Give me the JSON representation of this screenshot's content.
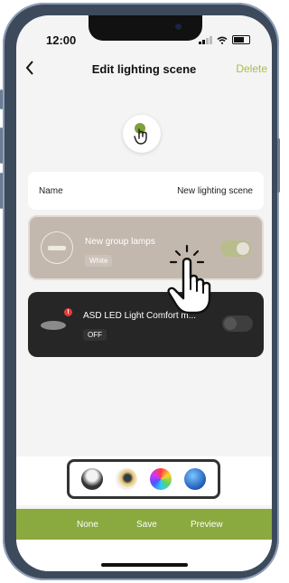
{
  "status_bar": {
    "time": "12:00"
  },
  "header": {
    "back_icon": "chevron-left-icon",
    "title": "Edit lighting scene",
    "delete_label": "Delete"
  },
  "scene_icon": {
    "icon": "tap-hand-icon",
    "accent_color": "#7fa13a"
  },
  "name_row": {
    "label": "Name",
    "value": "New lighting scene"
  },
  "devices": [
    {
      "name": "New group lamps",
      "tag": "White",
      "toggle_on": true,
      "selected": true
    },
    {
      "name": "ASD LED Light Comfort m...",
      "tag": "OFF",
      "toggle_on": false,
      "badge": "!"
    }
  ],
  "color_options": [
    "white-light-swatch",
    "warm-light-swatch",
    "rgb-color-wheel-swatch",
    "blue-globe-swatch"
  ],
  "bottom_bar": {
    "none_label": "None",
    "save_label": "Save",
    "preview_label": "Preview",
    "color": "#8aa93f"
  },
  "colors": {
    "accent": "#a9bc4b"
  }
}
